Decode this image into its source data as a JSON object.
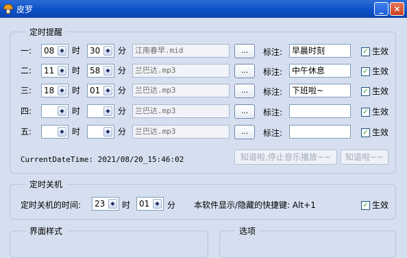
{
  "window": {
    "title": "皮罗"
  },
  "titlebar_buttons": {
    "minimize": "_",
    "close": "×"
  },
  "timer": {
    "group_title": "定时提醒",
    "hour_unit": "时",
    "minute_unit": "分",
    "browse_label": "...",
    "note_label": "标注:",
    "enable_label": "生效",
    "rows": [
      {
        "label": "一:",
        "hour": "08",
        "minute": "30",
        "file": "江南春早.mid",
        "note": "早晨时刻",
        "enabled": true
      },
      {
        "label": "二:",
        "hour": "11",
        "minute": "58",
        "file": "兰巴达.mp3",
        "note": "中午休息",
        "enabled": true
      },
      {
        "label": "三:",
        "hour": "18",
        "minute": "01",
        "file": "兰巴达.mp3",
        "note": "下班啦~",
        "enabled": true
      },
      {
        "label": "四:",
        "hour": "",
        "minute": "",
        "file": "兰巴达.mp3",
        "note": "",
        "enabled": true
      },
      {
        "label": "五:",
        "hour": "",
        "minute": "",
        "file": "兰巴达.mp3",
        "note": "",
        "enabled": true
      }
    ],
    "current_time": "CurrentDateTime: 2021/08/20_15:46:02",
    "stop_music_button": "知道啦,停止音乐播放~~",
    "ok_button": "知道啦~~"
  },
  "shutdown": {
    "group_title": "定时关机",
    "time_label": "定时关机的时间:",
    "hour": "23",
    "hour_unit": "时",
    "minute": "01",
    "minute_unit": "分",
    "hotkey_text": "本软件显示/隐藏的快捷键: Alt+1",
    "enable_label": "生效",
    "enabled": true
  },
  "style_group": {
    "title": "界面样式"
  },
  "options_group": {
    "title": "选项"
  },
  "check_mark": "✓",
  "spin_arrow": "◆"
}
